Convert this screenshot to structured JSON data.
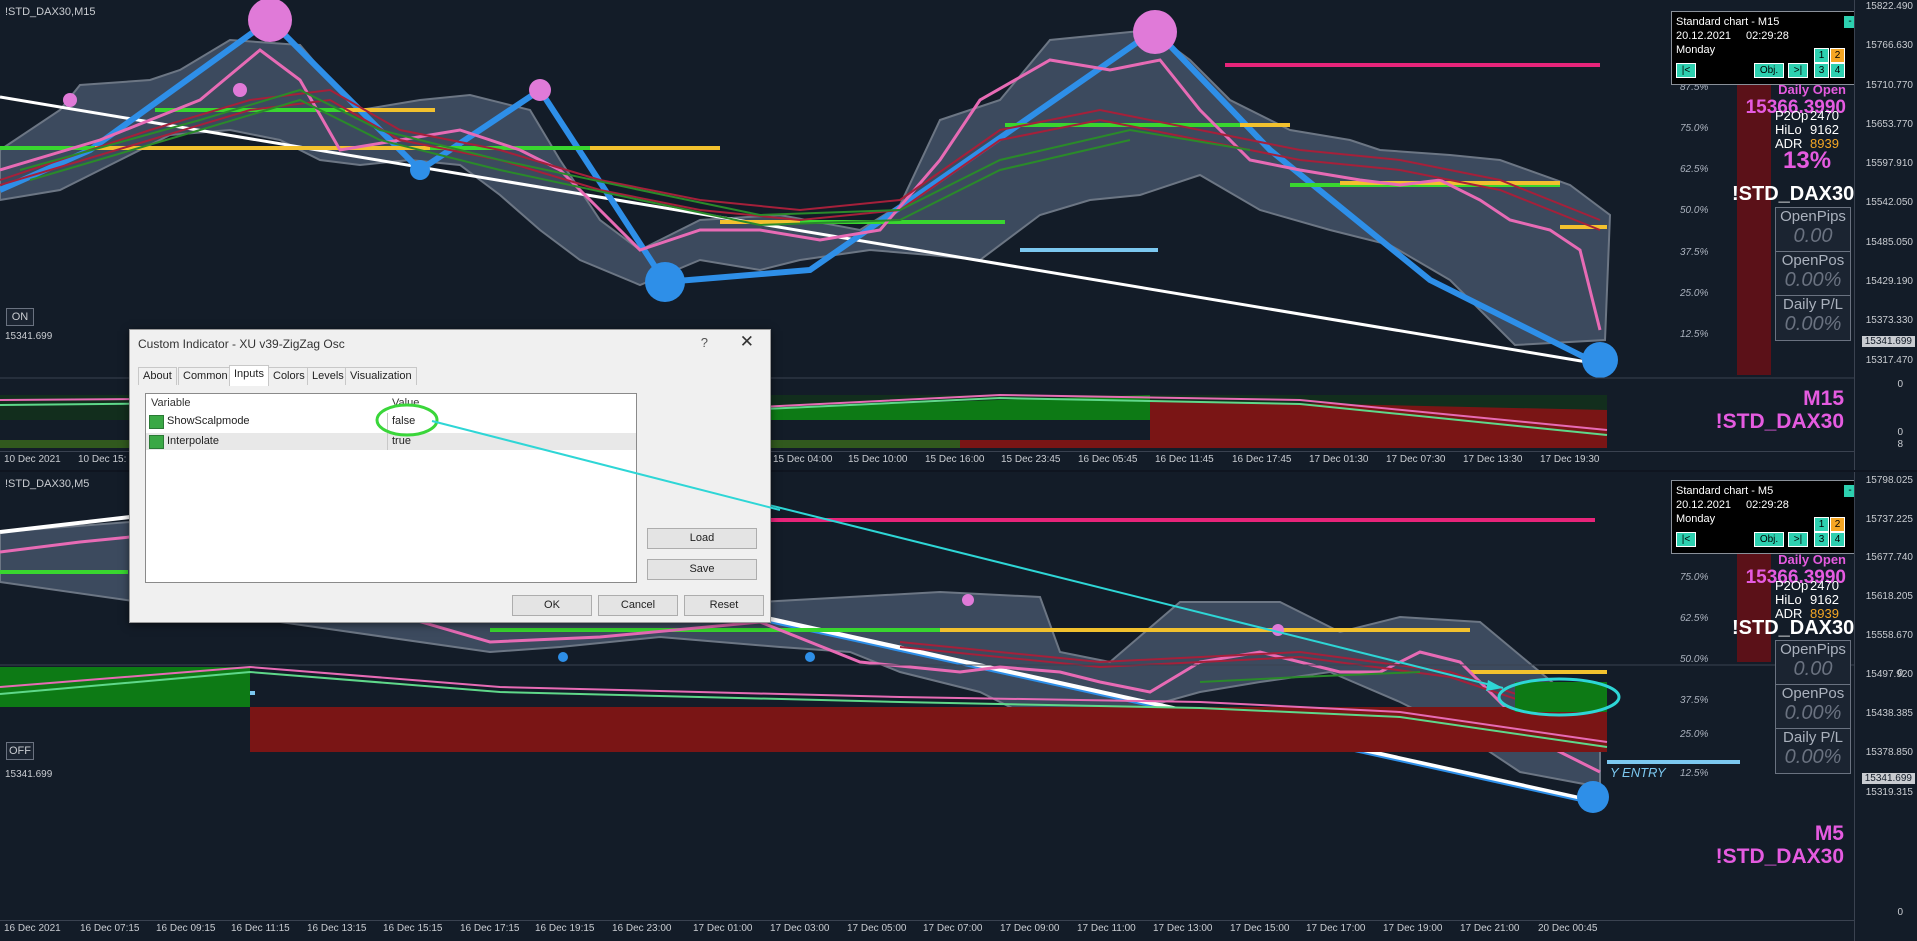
{
  "charts": [
    {
      "label": "!STD_DAX30,M15",
      "mode": "ON",
      "level_price": "15341.699",
      "price_ticks": [
        "15822.490",
        "15766.630",
        "15710.770",
        "15653.770",
        "15597.910",
        "15542.050",
        "15485.050",
        "15429.190",
        "15373.330",
        "15317.470"
      ],
      "current_price": "15341.699",
      "pct_levels": [
        "87.5%",
        "75.0%",
        "62.5%",
        "50.0%",
        "37.5%",
        "25.0%",
        "12.5%"
      ],
      "osc_ticks": [
        "0",
        "0",
        "8"
      ],
      "time_ticks": [
        "10 Dec 2021",
        "10 Dec 15:",
        "15 Dec 04:00",
        "15 Dec 10:00",
        "15 Dec 16:00",
        "15 Dec 23:45",
        "16 Dec 05:45",
        "16 Dec 11:45",
        "16 Dec 17:45",
        "17 Dec 01:30",
        "17 Dec 07:30",
        "17 Dec 13:30",
        "17 Dec 19:30"
      ],
      "info": {
        "title": "Standard chart - M15",
        "date": "20.12.2021",
        "time": "02:29:28",
        "day": "Monday",
        "btn_first": "|<",
        "btn_obj": "Obj.",
        "btn_last": ">|",
        "n1": "1",
        "n2": "2",
        "n3": "3",
        "n4": "4",
        "close": "-"
      },
      "daily_open_label": "Daily Open",
      "daily_open_value": "15366.3990",
      "p2op_label": "P2Op",
      "p2op_value": "2470",
      "hilo_label": "HiLo",
      "hilo_value": "9162",
      "adr_label": "ADR",
      "adr_value": "8939",
      "big_pct": "13%",
      "symbol": "!STD_DAX30",
      "open_pips_label": "OpenPips",
      "open_pips_value": "0.00",
      "open_pos_label": "OpenPos",
      "open_pos_value": "0.00%",
      "daily_pl_label": "Daily P/L",
      "daily_pl_value": "0.00%",
      "tf": "M15",
      "tf_symbol": "!STD_DAX30"
    },
    {
      "label": "!STD_DAX30,M5",
      "mode": "OFF",
      "level_price": "15341.699",
      "price_ticks": [
        "15798.025",
        "15737.225",
        "15677.740",
        "15618.205",
        "15558.670",
        "15497.920",
        "15438.385",
        "15378.850",
        "15319.315"
      ],
      "current_price": "15341.699",
      "pct_levels": [
        "75.0%",
        "62.5%",
        "50.0%",
        "37.5%",
        "25.0%",
        "12.5%"
      ],
      "entry_label": "Y ENTRY",
      "osc_ticks": [
        "0",
        "0"
      ],
      "time_ticks": [
        "16 Dec 2021",
        "16 Dec 07:15",
        "16 Dec 09:15",
        "16 Dec 11:15",
        "16 Dec 13:15",
        "16 Dec 15:15",
        "16 Dec 17:15",
        "16 Dec 19:15",
        "16 Dec 23:00",
        "17 Dec 01:00",
        "17 Dec 03:00",
        "17 Dec 05:00",
        "17 Dec 07:00",
        "17 Dec 09:00",
        "17 Dec 11:00",
        "17 Dec 13:00",
        "17 Dec 15:00",
        "17 Dec 17:00",
        "17 Dec 19:00",
        "17 Dec 21:00",
        "20 Dec 00:45"
      ],
      "info": {
        "title": "Standard chart - M5",
        "date": "20.12.2021",
        "time": "02:29:28",
        "day": "Monday",
        "btn_first": "|<",
        "btn_obj": "Obj.",
        "btn_last": ">|",
        "n1": "1",
        "n2": "2",
        "n3": "3",
        "n4": "4",
        "close": "-"
      },
      "daily_open_label": "Daily Open",
      "daily_open_value": "15366.3990",
      "p2op_label": "P2Op",
      "p2op_value": "2470",
      "hilo_label": "HiLo",
      "hilo_value": "9162",
      "adr_label": "ADR",
      "adr_value": "8939",
      "symbol": "!STD_DAX30",
      "open_pips_label": "OpenPips",
      "open_pips_value": "0.00",
      "open_pos_label": "OpenPos",
      "open_pos_value": "0.00%",
      "daily_pl_label": "Daily P/L",
      "daily_pl_value": "0.00%",
      "tf": "M5",
      "tf_symbol": "!STD_DAX30"
    }
  ],
  "dialog": {
    "title": "Custom Indicator - XU v39-ZigZag Osc",
    "help": "?",
    "close": "✕",
    "tabs": [
      "About",
      "Common",
      "Inputs",
      "Colors",
      "Levels",
      "Visualization"
    ],
    "active_tab": "Inputs",
    "col_variable": "Variable",
    "col_value": "Value",
    "rows": [
      {
        "name": "ShowScalpmode",
        "value": "false"
      },
      {
        "name": "Interpolate",
        "value": "true"
      }
    ],
    "load": "Load",
    "save": "Save",
    "ok": "OK",
    "cancel": "Cancel",
    "reset": "Reset"
  },
  "colors": {
    "zigzag": "#2e8fe8",
    "channel": "#4a5a70",
    "green_level": "#39d62f",
    "yellow_level": "#f2c12e",
    "magenta_level": "#e8247a",
    "light_blue_level": "#7cc8f0",
    "annotation": "#2ed6d6",
    "highlight_circle": "#3ad63a",
    "pivot": "#e07ad8"
  }
}
